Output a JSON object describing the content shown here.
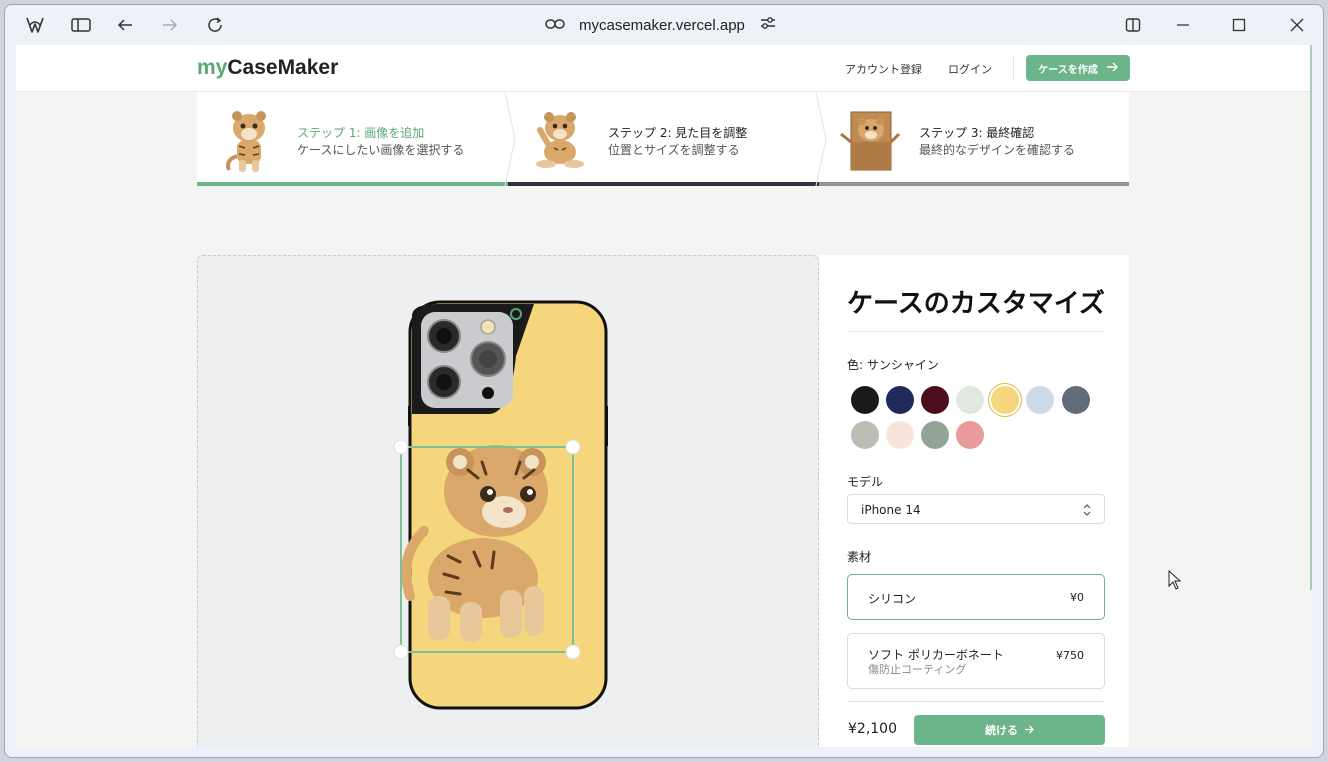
{
  "browser": {
    "url": "mycasemaker.vercel.app"
  },
  "nav": {
    "logo_my": "my",
    "logo_rest": "CaseMaker",
    "register": "アカウント登録",
    "login": "ログイン",
    "cta": "ケースを作成"
  },
  "steps": [
    {
      "title": "ステップ 1: 画像を追加",
      "desc": "ケースにしたい画像を選択する",
      "state": "complete"
    },
    {
      "title": "ステップ 2: 見た目を調整",
      "desc": "位置とサイズを調整する",
      "state": "current"
    },
    {
      "title": "ステップ 3: 最終確認",
      "desc": "最終的なデザインを確認する",
      "state": "upcoming"
    }
  ],
  "panel": {
    "title": "ケースのカスタマイズ",
    "color_label": "色: サンシャイン",
    "colors": [
      {
        "hex": "#18191b",
        "selected": false
      },
      {
        "hex": "#1e2b5c",
        "selected": false
      },
      {
        "hex": "#4b0f1c",
        "selected": false
      },
      {
        "hex": "#e1e8e0",
        "selected": false
      },
      {
        "hex": "#f5d67c",
        "selected": true
      },
      {
        "hex": "#cdd9ea",
        "selected": false
      },
      {
        "hex": "#646b7b",
        "selected": false
      },
      {
        "hex": "#bcbcb5",
        "selected": false
      },
      {
        "hex": "#f9e4dc",
        "selected": false
      },
      {
        "hex": "#94a494",
        "selected": false
      },
      {
        "hex": "#e99a9a",
        "selected": false
      }
    ],
    "model_label": "モデル",
    "model_value": "iPhone 14",
    "material_label": "素材",
    "materials": [
      {
        "name": "シリコン",
        "sub": "",
        "price": "¥0",
        "selected": true
      },
      {
        "name": "ソフト ポリカーボネート",
        "sub": "傷防止コーティング",
        "price": "¥750",
        "selected": false
      }
    ],
    "total": "¥2,100",
    "continue": "続ける"
  },
  "colors": {
    "accent": "#6cb48a",
    "case_color": "#f5d67c"
  }
}
